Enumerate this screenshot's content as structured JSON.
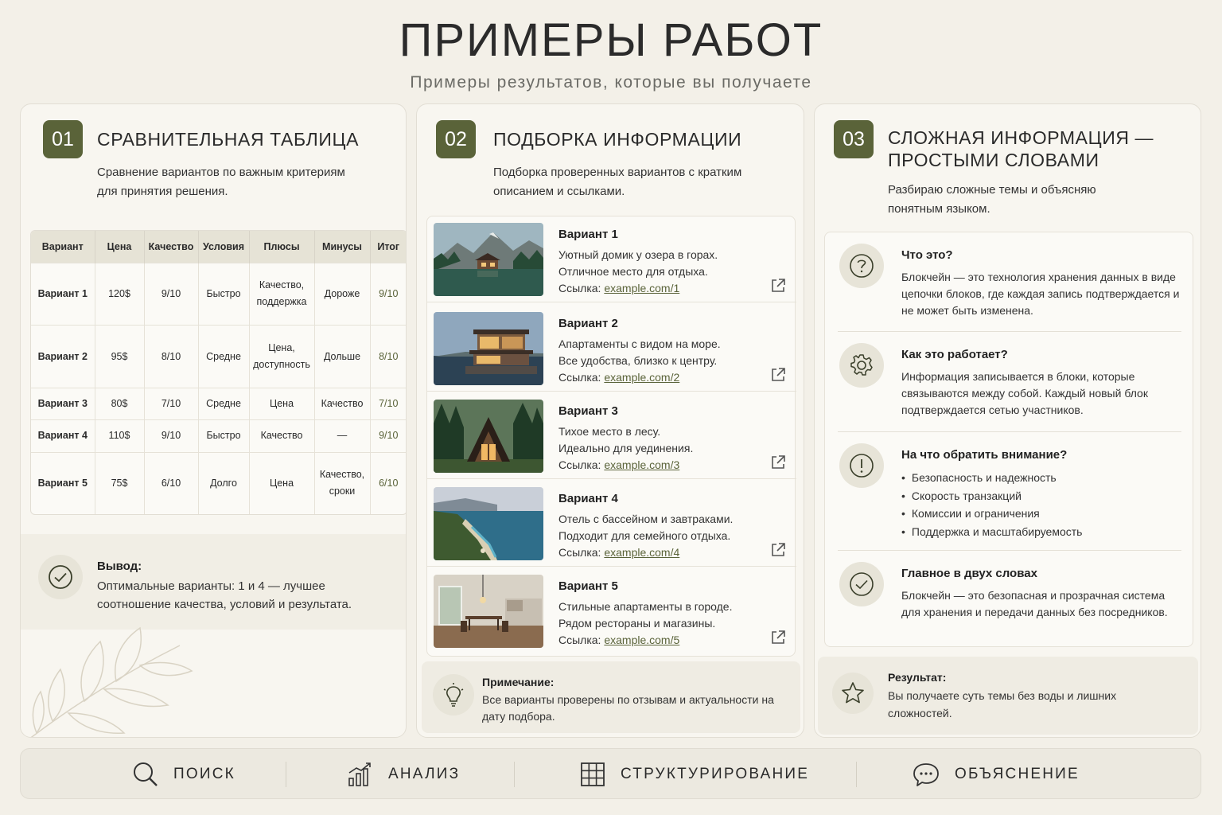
{
  "page": {
    "title": "ПРИМЕРЫ РАБОТ",
    "subtitle": "Примеры результатов, которые вы получаете"
  },
  "colors": {
    "accent": "#5a6339",
    "background": "#f3f0e8",
    "card": "#f8f6f0"
  },
  "card1": {
    "number": "01",
    "title": "СРАВНИТЕЛЬНАЯ ТАБЛИЦА",
    "desc": "Сравнение вариантов по важным критериям для принятия решения.",
    "table": {
      "headers": [
        "Вариант",
        "Цена",
        "Качество",
        "Условия",
        "Плюсы",
        "Минусы",
        "Итог"
      ],
      "rows": [
        [
          "Вариант 1",
          "120$",
          "9/10",
          "Быстро",
          "Качество, поддержка",
          "Дороже",
          "9/10"
        ],
        [
          "Вариант 2",
          "95$",
          "8/10",
          "Средне",
          "Цена, доступность",
          "Дольше",
          "8/10"
        ],
        [
          "Вариант 3",
          "80$",
          "7/10",
          "Средне",
          "Цена",
          "Качество",
          "7/10"
        ],
        [
          "Вариант 4",
          "110$",
          "9/10",
          "Быстро",
          "Качество",
          "—",
          "9/10"
        ],
        [
          "Вариант 5",
          "75$",
          "6/10",
          "Долго",
          "Цена",
          "Качество, сроки",
          "6/10"
        ]
      ]
    },
    "conclusion_title": "Вывод:",
    "conclusion_text": "Оптимальные варианты: 1 и 4 — лучшее соотношение качества, условий и результата.",
    "icon": "check-circle-icon"
  },
  "card2": {
    "number": "02",
    "title": "ПОДБОРКА ИНФОРМАЦИИ",
    "desc": "Подборка проверенных вариантов с кратким описанием и ссылками.",
    "options": [
      {
        "title": "Вариант 1",
        "line1": "Уютный домик у озера в горах.",
        "line2": "Отличное место для отдыха.",
        "link_label": "Ссылка:",
        "link": "example.com/1",
        "image": "lake-house"
      },
      {
        "title": "Вариант 2",
        "line1": "Апартаменты с видом на море.",
        "line2": "Все удобства, близко к центру.",
        "link_label": "Ссылка:",
        "link": "example.com/2",
        "image": "modern-villa"
      },
      {
        "title": "Вариант 3",
        "line1": "Тихое место в лесу.",
        "line2": "Идеально для уединения.",
        "link_label": "Ссылка:",
        "link": "example.com/3",
        "image": "forest-cabin"
      },
      {
        "title": "Вариант 4",
        "line1": "Отель с бассейном и завтраками.",
        "line2": "Подходит для семейного отдыха.",
        "link_label": "Ссылка:",
        "link": "example.com/4",
        "image": "sea-coast"
      },
      {
        "title": "Вариант 5",
        "line1": "Стильные апартаменты в городе.",
        "line2": "Рядом рестораны и магазины.",
        "link_label": "Ссылка:",
        "link": "example.com/5",
        "image": "city-apartment"
      }
    ],
    "note_title": "Примечание:",
    "note_text": "Все варианты проверены по отзывам и актуальности на дату подбора.",
    "icon": "lightbulb-icon"
  },
  "card3": {
    "number": "03",
    "title": "СЛОЖНАЯ ИНФОРМАЦИЯ — ПРОСТЫМИ СЛОВАМИ",
    "desc": "Разбираю сложные темы и объясняю понятным языком.",
    "sections": [
      {
        "title": "Что это?",
        "text": "Блокчейн — это технология хранения данных в виде цепочки блоков, где каждая запись подтверждается и не может быть изменена.",
        "icon": "question-icon"
      },
      {
        "title": "Как это работает?",
        "text": "Информация записывается в блоки, которые связываются между собой. Каждый новый блок подтверждается сетью участников.",
        "icon": "gear-icon"
      },
      {
        "title": "На что обратить внимание?",
        "items": [
          "Безопасность и надежность",
          "Скорость транзакций",
          "Комиссии и ограничения",
          "Поддержка и масштабируемость"
        ],
        "icon": "exclamation-icon"
      },
      {
        "title": "Главное в двух словах",
        "text": "Блокчейн — это безопасная и прозрачная система для хранения и передачи данных без посредников.",
        "icon": "check-circle-icon"
      }
    ],
    "result_title": "Результат:",
    "result_text": "Вы получаете суть темы без воды и лишних сложностей.",
    "icon": "star-icon"
  },
  "bar": {
    "items": [
      {
        "label": "ПОИСК",
        "icon": "search-icon"
      },
      {
        "label": "АНАЛИЗ",
        "icon": "chart-icon"
      },
      {
        "label": "СТРУКТУРИРОВАНИЕ",
        "icon": "grid-icon"
      },
      {
        "label": "ОБЪЯСНЕНИЕ",
        "icon": "chat-icon"
      }
    ]
  }
}
